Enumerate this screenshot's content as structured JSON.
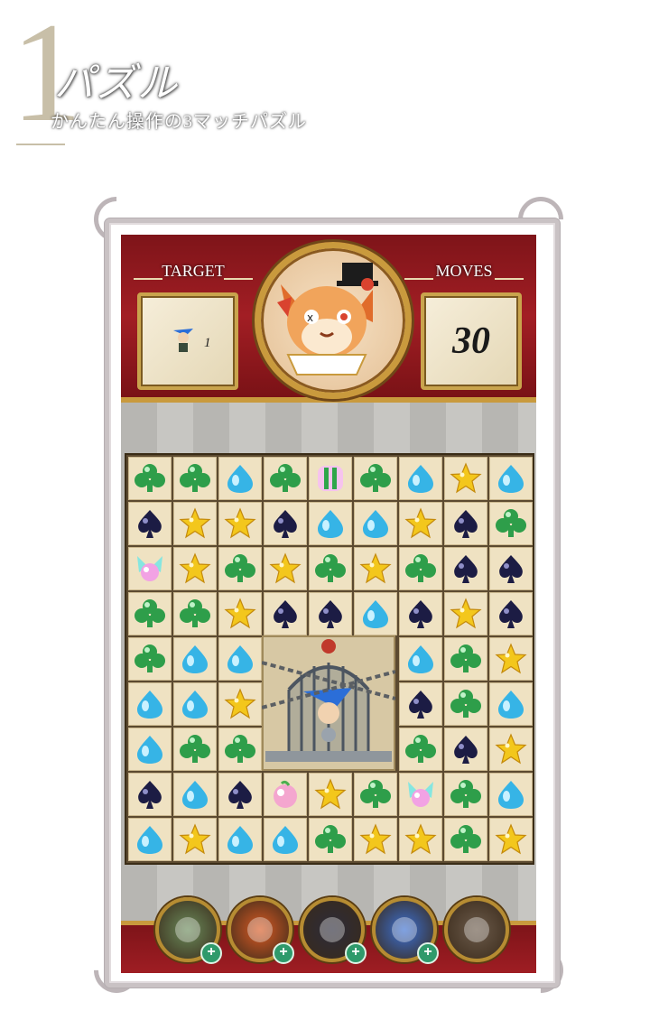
{
  "header": {
    "number": "1",
    "title": "パズル",
    "subtitle": "かんたん操作の3マッチパズル"
  },
  "game": {
    "target_label": "TARGET",
    "target_count": "1",
    "moves_label": "MOVES",
    "moves_value": "30",
    "portrait_icon": "harlequin-cat-icon",
    "board": [
      [
        "club",
        "club",
        "drop",
        "club",
        "special-green",
        "club",
        "drop",
        "star",
        "drop"
      ],
      [
        "spade",
        "star",
        "star",
        "spade",
        "drop",
        "drop",
        "star",
        "spade",
        "club"
      ],
      [
        "fairy",
        "star",
        "club",
        "star",
        "club",
        "star",
        "club",
        "spade",
        "spade"
      ],
      [
        "club",
        "club",
        "star",
        "spade",
        "spade",
        "drop",
        "spade",
        "star",
        "spade"
      ],
      [
        "club",
        "drop",
        "drop",
        "cage",
        "cage",
        "cage",
        "drop",
        "club",
        "star"
      ],
      [
        "drop",
        "drop",
        "star",
        "cage",
        "cage",
        "cage",
        "spade",
        "club",
        "drop"
      ],
      [
        "drop",
        "club",
        "club",
        "cage",
        "cage",
        "cage",
        "club",
        "spade",
        "star"
      ],
      [
        "spade",
        "drop",
        "spade",
        "peach",
        "star",
        "club",
        "fairy",
        "club",
        "drop"
      ],
      [
        "drop",
        "star",
        "drop",
        "drop",
        "club",
        "star",
        "star",
        "club",
        "star"
      ]
    ],
    "items": [
      {
        "icon": "magic-staff-icon",
        "plus": "+"
      },
      {
        "icon": "fire-bird-icon",
        "plus": "+"
      },
      {
        "icon": "thunder-cloud-icon",
        "plus": "+"
      },
      {
        "icon": "whirlwind-icon",
        "plus": "+"
      },
      {
        "icon": "gear-icon",
        "plus": ""
      }
    ],
    "colors": {
      "club": "#2e9e4a",
      "spade": "#1c1c44",
      "drop": "#36b4e6",
      "star": "#f3c71c",
      "bar": "#8f1a1f",
      "gold": "#c99a3d"
    }
  }
}
